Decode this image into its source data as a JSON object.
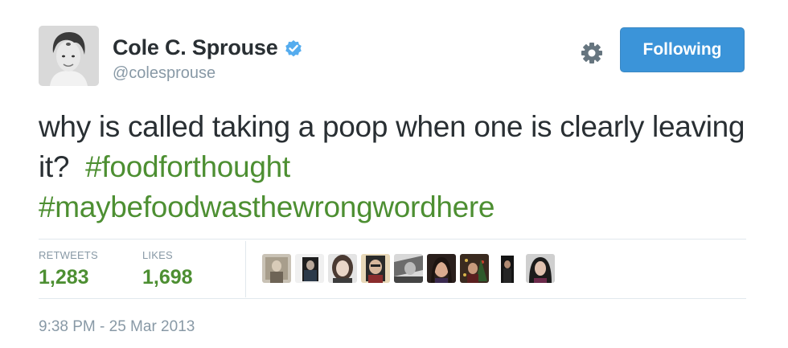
{
  "user": {
    "display_name": "Cole C. Sprouse",
    "handle": "@colesprouse",
    "verified": true
  },
  "follow_button": {
    "label": "Following",
    "color": "#3b94d9"
  },
  "tweet": {
    "text_part1": "why is called taking a poop when one is clearly leaving it?",
    "hashtag1": "#foodforthought",
    "hashtag2": "#maybefoodwasthewrongwordhere"
  },
  "stats": {
    "retweets_label": "RETWEETS",
    "retweets_value": "1,283",
    "likes_label": "LIKES",
    "likes_value": "1,698"
  },
  "timestamp": "9:38 PM - 25 Mar 2013",
  "colors": {
    "hashtag": "#4d8f32",
    "muted": "#8899a6",
    "text": "#292f33"
  }
}
